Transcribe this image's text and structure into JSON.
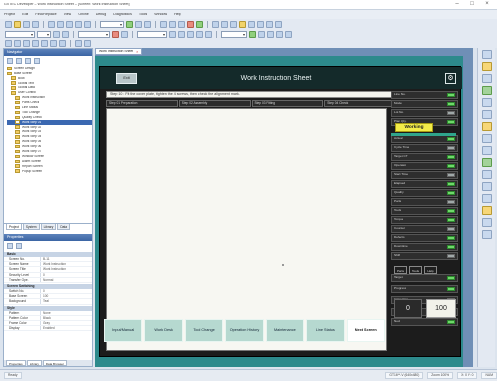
{
  "app": {
    "title": "GX IEC Developer – Work Instruction Sheet – [Screen: Work Instruction Sheet]",
    "menu": [
      "Project",
      "Edit",
      "Find/Replace",
      "View",
      "Online",
      "Debug",
      "Diagnostics",
      "Tools",
      "Window",
      "Help"
    ]
  },
  "explorer": {
    "title": "Navigator",
    "tree": [
      "Screen Design",
      "Base Screen",
      "Boot",
      "Global Text",
      "Global Data",
      "User Control",
      "Work Instruction",
      "Parts Check",
      "Line Status",
      "Tool Change",
      "Quality Check",
      "Work Step 01",
      "Work Step 02",
      "Work Step 03",
      "Work Step 04",
      "Work Step 05",
      "Work Step 06",
      "Work Step 07",
      "Window Screen",
      "Alarm Screen",
      "Report Screen",
      "Popup Screen"
    ],
    "selected_index": 11,
    "tabs": [
      "Project",
      "System",
      "Library",
      "Data"
    ]
  },
  "properties": {
    "title": "Properties",
    "sections": [
      {
        "name": "Basic",
        "rows": [
          [
            "Screen No.",
            "B-11"
          ],
          [
            "Screen Name",
            "Work Instruction"
          ],
          [
            "Screen Title",
            "Work Instruction"
          ],
          [
            "Security Level",
            "0"
          ],
          [
            "Transfer Ope.",
            "Normal"
          ]
        ]
      },
      {
        "name": "Screen Switching",
        "rows": [
          [
            "Switch No.",
            "0"
          ],
          [
            "Base Screen",
            "100"
          ],
          [
            "Background",
            "Teal"
          ]
        ]
      },
      {
        "name": "Style",
        "rows": [
          [
            "Pattern",
            "None"
          ],
          [
            "Pattern Color",
            "Black"
          ],
          [
            "Frame Color",
            "Gray"
          ],
          [
            "Display",
            "Enabled"
          ]
        ]
      }
    ],
    "tabs": [
      "Properties",
      "Library",
      "Data Browser"
    ]
  },
  "doc_tab": {
    "label": "Work Instruction Sheet"
  },
  "screen": {
    "exit_label": "Exit",
    "title": "Work Instruction Sheet",
    "instruction": "Step 10 : Fit the cover plate, tighten the 4 screws, then check the alignment mark.",
    "step_tabs": [
      "Step 01 Preparation",
      "Step 02 Assembly",
      "Step 03 Fitting",
      "Step 04 Check"
    ],
    "working_label": "Working",
    "right_rows": [
      "Line No.",
      "Model",
      "Lot No.",
      "Plan Qty.",
      "Actual",
      "Cycle Time",
      "Target CT",
      "Operator",
      "Start Time",
      "Elapsed",
      "Quality",
      "Parts",
      "Tools",
      "Torque",
      "Counter",
      "Defects",
      "Downtime",
      "Shift",
      "Target",
      "Progress",
      "Inspection",
      "Previous",
      "Next"
    ],
    "right_buttons": [
      "Parts",
      "Tools",
      "Help"
    ],
    "numbers": {
      "a": "0",
      "b": "100"
    },
    "bottom_buttons": [
      "Input/Manual",
      "Work Desk",
      "Tool Change",
      "Operation History",
      "Maintenance",
      "Line Status",
      "Next Screen"
    ]
  },
  "statusbar": [
    "Ready",
    "GT16**-V (640x480)",
    "Zoom 100%",
    "X:   0  Y:   0",
    "NUM"
  ]
}
